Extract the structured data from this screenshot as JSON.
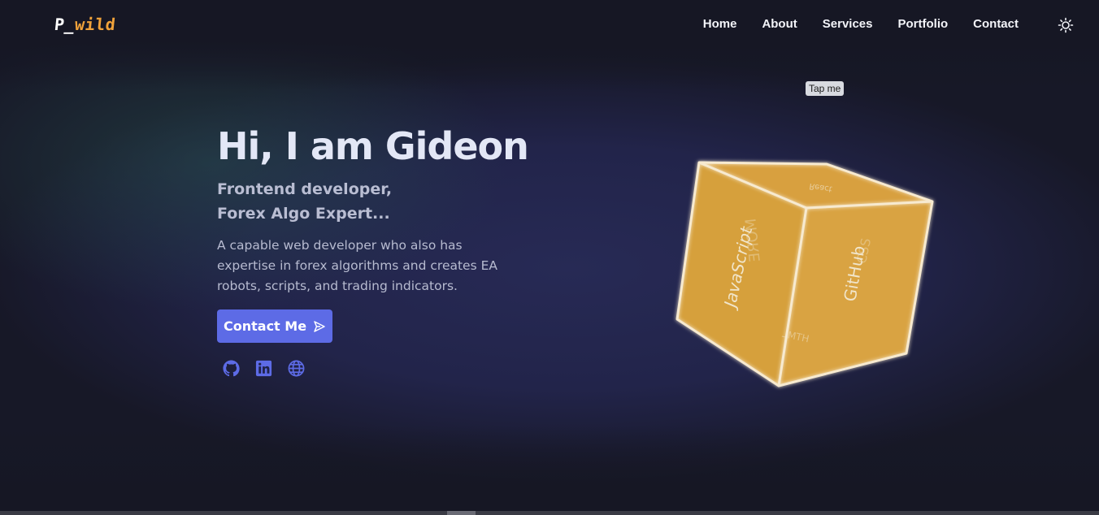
{
  "brand": {
    "logo_part1": "P_",
    "logo_part2": "wild",
    "logo_color": "#f0a23a"
  },
  "nav": {
    "items": [
      "Home",
      "About",
      "Services",
      "Portfolio",
      "Contact"
    ],
    "theme_icon": "sun-icon"
  },
  "tooltip": {
    "text": "Tap me"
  },
  "hero": {
    "title": "Hi, I am Gideon",
    "subtitle_line1": "Frontend developer,",
    "subtitle_line2": "Forex Algo Expert...",
    "description": "A capable web developer who also has expertise in forex algorithms and creates EA robots, scripts, and trading indicators.",
    "cta_label": "Contact Me",
    "cta_icon": "send-icon",
    "accent_color": "#5d6be6"
  },
  "socials": [
    {
      "icon": "github-icon"
    },
    {
      "icon": "linkedin-icon"
    },
    {
      "icon": "globe-icon"
    }
  ],
  "cube": {
    "faces": [
      "JavaScript",
      "GitHub",
      "MORE",
      "CSS",
      "HTML",
      "React"
    ],
    "face_color": "#d8a03f"
  }
}
